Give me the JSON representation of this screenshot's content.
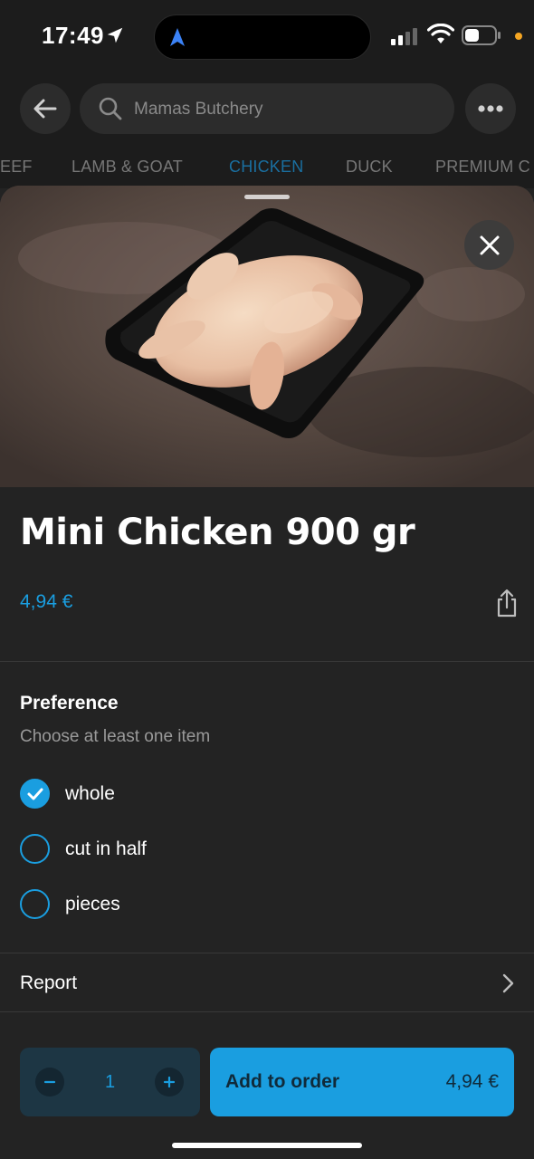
{
  "status_bar": {
    "time": "17:49",
    "icons": [
      "location-arrow-icon",
      "navigation-arrow-icon",
      "cellular-signal-icon",
      "wifi-icon",
      "battery-icon"
    ],
    "accent_dot_color": "#f5a623"
  },
  "top_nav": {
    "back_icon": "arrow-left-icon",
    "search_placeholder": "Mamas Butchery",
    "more_icon": "ellipsis-icon"
  },
  "categories": {
    "items": [
      {
        "label": "EEF",
        "active": false
      },
      {
        "label": "LAMB & GOAT",
        "active": false
      },
      {
        "label": "CHICKEN",
        "active": true
      },
      {
        "label": "DUCK",
        "active": false
      },
      {
        "label": "PREMIUM C",
        "active": false
      }
    ]
  },
  "product": {
    "image": "raw-chicken-in-black-tray",
    "title": "Mini Chicken 900 gr",
    "price": "4,94 €",
    "share_icon": "share-icon",
    "close_icon": "close-icon"
  },
  "preference": {
    "title": "Preference",
    "subtitle": "Choose at least one item",
    "options": [
      {
        "label": "whole",
        "selected": true
      },
      {
        "label": "cut in half",
        "selected": false
      },
      {
        "label": "pieces",
        "selected": false
      }
    ]
  },
  "report": {
    "label": "Report"
  },
  "order": {
    "quantity": "1",
    "add_label": "Add to order",
    "total": "4,94 €"
  },
  "colors": {
    "accent": "#1a9ee0",
    "background": "#232323",
    "header": "#1c1c1c"
  }
}
